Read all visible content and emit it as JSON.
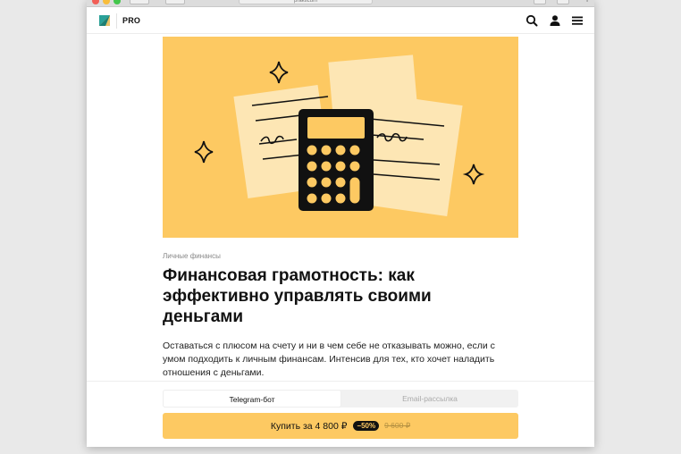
{
  "browser": {
    "url": "prakticum"
  },
  "header": {
    "section_label": "PRO",
    "icons": [
      "search-icon",
      "user-icon",
      "menu-icon"
    ]
  },
  "article": {
    "category": "Личные финансы",
    "title": "Финансовая грамотность: как эффективно управлять своими деньгами",
    "description": "Оставаться с плюсом на счету и ни в чем себе не отказывать можно, если с умом подходить к личным финансам. Интенсив для тех, кто хочет наладить отношения с деньгами.",
    "hero_icon": "calculator-illustration"
  },
  "delivery_tabs": {
    "items": [
      {
        "label": "Telegram-бот",
        "active": true
      },
      {
        "label": "Email-рассылка",
        "active": false
      }
    ]
  },
  "purchase": {
    "label": "Купить за 4 800 ₽",
    "discount": "−50%",
    "old_price": "9 600 ₽"
  },
  "colors": {
    "accent": "#fdc962",
    "text": "#111111"
  }
}
